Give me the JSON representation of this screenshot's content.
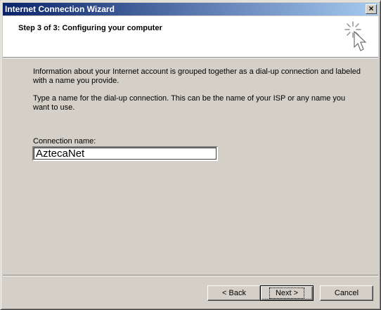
{
  "window": {
    "title": "Internet Connection Wizard",
    "close_label": "×"
  },
  "header": {
    "title": "Step 3 of 3: Configuring your computer",
    "icon": "wizard-cursor-sparkle-icon"
  },
  "content": {
    "paragraph1": "Information about your Internet account is grouped together as a dial-up connection and labeled with a name you provide.",
    "paragraph2": "Type a name for the dial-up connection. This can be the name of your ISP or any name you want to use."
  },
  "connection": {
    "label": "Connection name:",
    "value": "AztecaNet"
  },
  "buttons": {
    "back": "< Back",
    "next": "Next >",
    "cancel": "Cancel"
  },
  "colors": {
    "titlebar_start": "#0a246a",
    "titlebar_end": "#a6caf0",
    "face": "#d4d0c8"
  }
}
